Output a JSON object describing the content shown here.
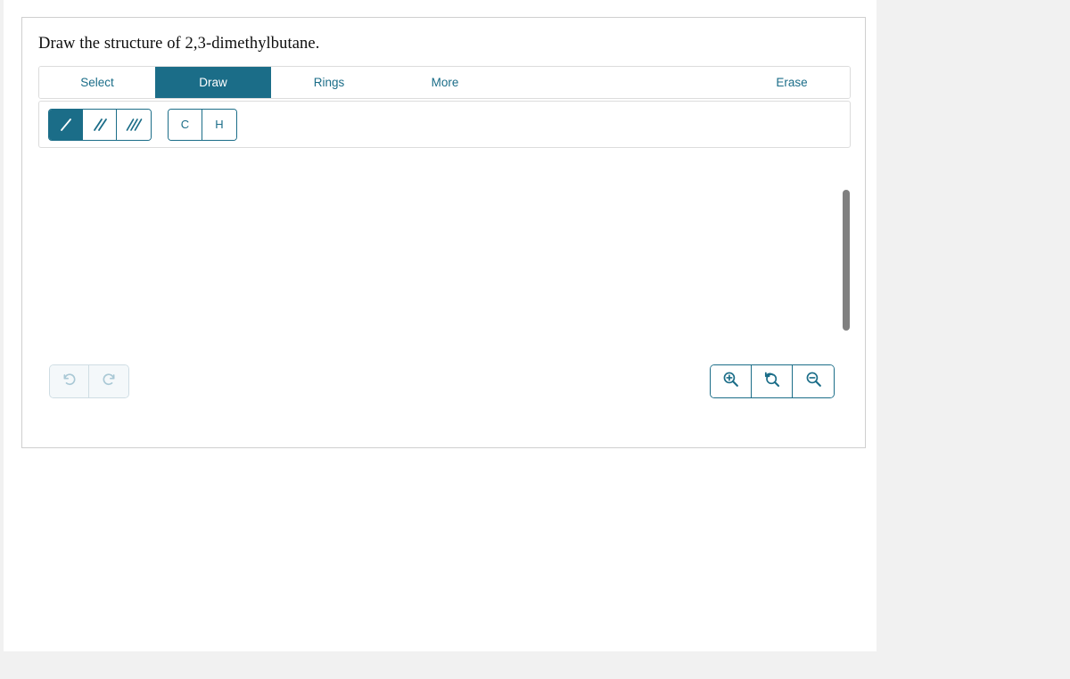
{
  "prompt": {
    "text": "Draw the structure of 2,3-dimethylbutane."
  },
  "colors": {
    "accent_teal": "#1b6d88",
    "disabled_icon": "#a9c8d5",
    "border_light": "#dcdcdc",
    "scrollbar_thumb": "#808080",
    "page_background": "#f1f1f1"
  },
  "tabs": [
    {
      "id": "select",
      "label": "Select",
      "active": false
    },
    {
      "id": "draw",
      "label": "Draw",
      "active": true
    },
    {
      "id": "rings",
      "label": "Rings",
      "active": false
    },
    {
      "id": "more",
      "label": "More",
      "active": false
    },
    {
      "id": "erase",
      "label": "Erase",
      "active": false
    }
  ],
  "toolbar": {
    "bond_tools": [
      {
        "id": "single-bond",
        "icon": "single-bond-icon",
        "active": true
      },
      {
        "id": "double-bond",
        "icon": "double-bond-icon",
        "active": false
      },
      {
        "id": "triple-bond",
        "icon": "triple-bond-icon",
        "active": false
      }
    ],
    "atom_tools": [
      {
        "id": "carbon",
        "label": "C",
        "active": false
      },
      {
        "id": "hydrogen",
        "label": "H",
        "active": false
      }
    ]
  },
  "history": {
    "undo": {
      "icon": "undo-arrow-icon",
      "enabled": false
    },
    "redo": {
      "icon": "redo-arrow-icon",
      "enabled": false
    }
  },
  "zoom_controls": [
    {
      "id": "zoom-in",
      "icon": "magnifier-plus-icon"
    },
    {
      "id": "zoom-reset",
      "icon": "magnifier-reset-icon"
    },
    {
      "id": "zoom-out",
      "icon": "magnifier-minus-icon"
    }
  ],
  "canvas": {
    "content": "",
    "scrollbar_visible": true
  }
}
